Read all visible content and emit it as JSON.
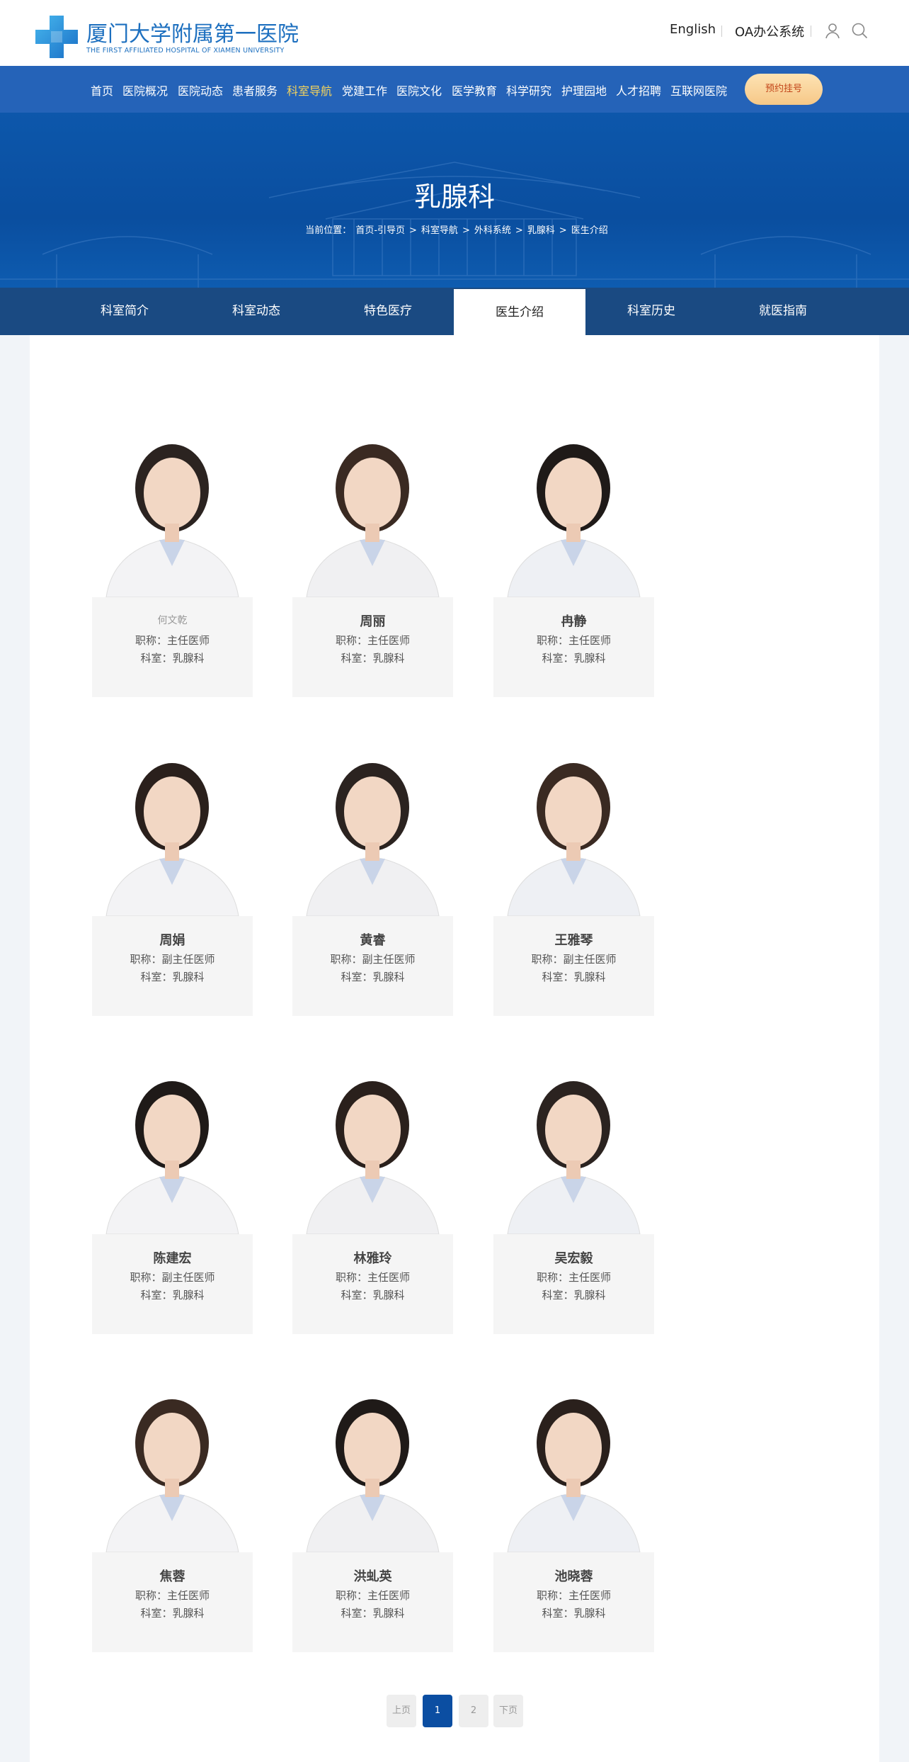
{
  "header": {
    "logo_cn": "厦门大学附属第一医院",
    "logo_en": "THE FIRST AFFILIATED HOSPITAL OF XIAMEN UNIVERSITY",
    "english_link": "English",
    "oa_link": "OA办公系统",
    "colors": {
      "brand": "#1c6fbf",
      "nav_bg": "#2563b8",
      "banner_bg": "#0a4e9f",
      "active": "#f3d35d"
    }
  },
  "nav": {
    "items": [
      "首页",
      "医院概况",
      "医院动态",
      "患者服务",
      "科室导航",
      "党建工作",
      "医院文化",
      "医学教育",
      "科学研究",
      "护理园地",
      "人才招聘",
      "互联网医院"
    ],
    "active_index": 4,
    "cta": "预约挂号"
  },
  "banner": {
    "title": "乳腺科",
    "crumb_label": "当前位置：",
    "crumbs": [
      "首页-引导页",
      "科室导航",
      "外科系统",
      "乳腺科",
      "医生介绍"
    ],
    "separator": ">"
  },
  "tabs": {
    "items": [
      "科室简介",
      "科室动态",
      "特色医疗",
      "医生介绍",
      "科室历史",
      "就医指南"
    ],
    "active_index": 3
  },
  "doctors": [
    {
      "name": "何文乾",
      "title": "职称：主任医师",
      "dept": "科室：乳腺科",
      "photo": "doctor-photo"
    },
    {
      "name": "周丽",
      "title": "职称：主任医师",
      "dept": "科室：乳腺科",
      "photo": "doctor-photo"
    },
    {
      "name": "冉静",
      "title": "职称：主任医师",
      "dept": "科室：乳腺科",
      "photo": "doctor-photo"
    },
    {
      "name": "周娟",
      "title": "职称：副主任医师",
      "dept": "科室：乳腺科",
      "photo": "doctor-photo"
    },
    {
      "name": "黄睿",
      "title": "职称：副主任医师",
      "dept": "科室：乳腺科",
      "photo": "doctor-photo"
    },
    {
      "name": "王雅琴",
      "title": "职称：副主任医师",
      "dept": "科室：乳腺科",
      "photo": "doctor-photo"
    },
    {
      "name": "陈建宏",
      "title": "职称：副主任医师",
      "dept": "科室：乳腺科",
      "photo": "doctor-photo"
    },
    {
      "name": "林雅玲",
      "title": "职称：主任医师",
      "dept": "科室：乳腺科",
      "photo": "doctor-photo"
    },
    {
      "name": "吴宏毅",
      "title": "职称：主任医师",
      "dept": "科室：乳腺科",
      "photo": "doctor-photo"
    },
    {
      "name": "焦蓉",
      "title": "职称：主任医师",
      "dept": "科室：乳腺科",
      "photo": "doctor-photo"
    },
    {
      "name": "洪虬英",
      "title": "职称：主任医师",
      "dept": "科室：乳腺科",
      "photo": "doctor-photo"
    },
    {
      "name": "池晓蓉",
      "title": "职称：主任医师",
      "dept": "科室：乳腺科",
      "photo": "doctor-photo"
    }
  ],
  "pagination": {
    "prev": "上页",
    "pages": [
      "1",
      "2"
    ],
    "current": "1",
    "next": "下页"
  }
}
